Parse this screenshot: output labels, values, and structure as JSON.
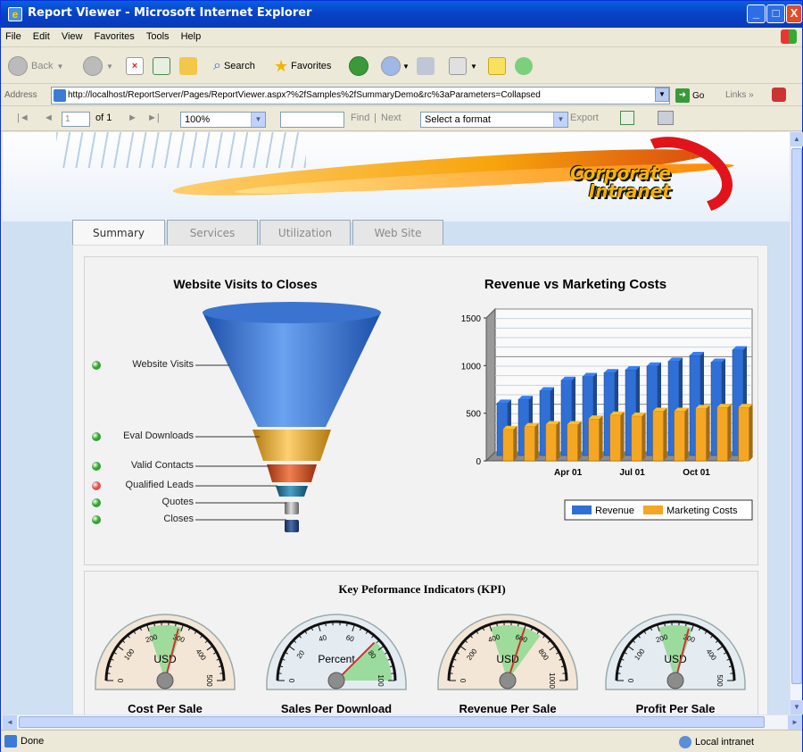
{
  "window": {
    "title": "Report Viewer - Microsoft Internet Explorer",
    "minimize": "_",
    "maximize": "□",
    "close": "X"
  },
  "menu": [
    "File",
    "Edit",
    "View",
    "Favorites",
    "Tools",
    "Help"
  ],
  "toolbar": {
    "back_label": "Back",
    "search_label": "Search",
    "favorites_label": "Favorites"
  },
  "address": {
    "label": "Address",
    "url": "http://localhost/ReportServer/Pages/ReportViewer.aspx?%2fSamples%2fSummaryDemo&rc%3aParameters=Collapsed",
    "go_label": "Go",
    "links_label": "Links"
  },
  "report_toolbar": {
    "page_value": "1",
    "page_of": "of 1",
    "zoom": "100%",
    "find_label": "Find",
    "separator": "|",
    "next_label": "Next",
    "format_placeholder": "Select a format",
    "export_label": "Export"
  },
  "banner": {
    "logo_line1": "Corporate",
    "logo_line2": "Intranet"
  },
  "tabs": [
    {
      "label": "Summary",
      "active": true
    },
    {
      "label": "Services",
      "active": false
    },
    {
      "label": "Utilization",
      "active": false
    },
    {
      "label": "Web Site",
      "active": false
    }
  ],
  "funnel": {
    "title": "Website Visits to Closes",
    "stages": [
      {
        "label": "Website Visits",
        "status": "green"
      },
      {
        "label": "Eval Downloads",
        "status": "green"
      },
      {
        "label": "Valid Contacts",
        "status": "green"
      },
      {
        "label": "Qualified Leads",
        "status": "red"
      },
      {
        "label": "Quotes",
        "status": "green"
      },
      {
        "label": "Closes",
        "status": "green"
      }
    ],
    "colors": {
      "green": "#2fa52f",
      "red": "#e05050"
    }
  },
  "chart_data": {
    "type": "bar",
    "title": "Revenue vs Marketing Costs",
    "xlabel": "",
    "ylabel": "",
    "ylim": [
      0,
      1500
    ],
    "yticks": [
      0,
      500,
      1000,
      1500
    ],
    "x_tick_labels": [
      {
        "index": 3,
        "label": "Apr 01"
      },
      {
        "index": 6,
        "label": "Jul 01"
      },
      {
        "index": 9,
        "label": "Oct 01"
      }
    ],
    "categories": [
      "1",
      "2",
      "3",
      "4",
      "5",
      "6",
      "7",
      "8",
      "9",
      "10",
      "11",
      "12"
    ],
    "series": [
      {
        "name": "Revenue",
        "color": "#2f6fd6",
        "values": [
          550,
          590,
          680,
          790,
          830,
          870,
          900,
          940,
          990,
          1050,
          980,
          1110
        ]
      },
      {
        "name": "Marketing Costs",
        "color": "#f5a623",
        "values": [
          330,
          360,
          380,
          380,
          440,
          480,
          470,
          520,
          520,
          550,
          560,
          560
        ]
      }
    ],
    "legend": "bottom"
  },
  "kpi": {
    "title": "Key Peformance Indicators (KPI)",
    "gauges": [
      {
        "label": "Cost Per Sale",
        "unit": "USD",
        "ticks": [
          "0",
          "100",
          "200",
          "300",
          "400",
          "500"
        ],
        "max": 500,
        "value": 290,
        "band": [
          200,
          300
        ],
        "style": "warm"
      },
      {
        "label": "Sales Per Download",
        "unit": "Percent",
        "ticks": [
          "0",
          "20",
          "40",
          "60",
          "80",
          "100"
        ],
        "max": 100,
        "value": 75,
        "band": [
          75,
          100
        ],
        "style": "cool"
      },
      {
        "label": "Revenue Per Sale",
        "unit": "USD",
        "ticks": [
          "0",
          "200",
          "400",
          "600",
          "800",
          "1000"
        ],
        "max": 1000,
        "value": 600,
        "band": [
          400,
          700
        ],
        "style": "warm"
      },
      {
        "label": "Profit Per Sale",
        "unit": "USD",
        "ticks": [
          "0",
          "100",
          "200",
          "300",
          "400",
          "500"
        ],
        "max": 500,
        "value": 290,
        "band": [
          200,
          300
        ],
        "style": "cool"
      }
    ]
  },
  "status": {
    "text": "Done",
    "zone": "Local intranet"
  }
}
